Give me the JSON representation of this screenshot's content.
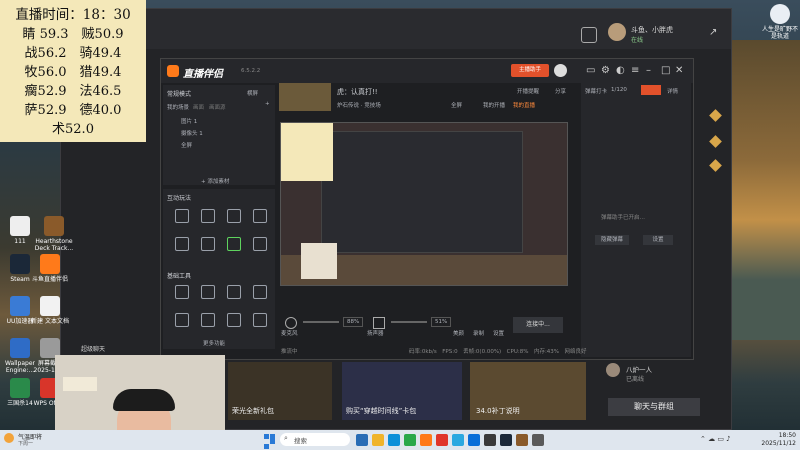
{
  "stats": {
    "title": "直播时间：18：30",
    "rows": [
      "睛 59.3　贼50.9",
      "战56.2　骑49.4",
      "牧56.0　猎49.4",
      "瘸52.9　法46.5",
      "萨52.9　德40.0",
      "术52.0"
    ]
  },
  "desktop_icons": [
    {
      "label": "111"
    },
    {
      "label": "Hearthstone Deck Track..."
    },
    {
      "label": "Steam"
    },
    {
      "label": "斗鱼直播伴侣"
    },
    {
      "label": "UU加速器"
    },
    {
      "label": "新建 文本文档"
    },
    {
      "label": "Wallpaper Engine:..."
    },
    {
      "label": "屏幕截图 2025-10-..."
    },
    {
      "label": "三国杀14"
    },
    {
      "label": "WPS Office"
    }
  ],
  "top_right_icon": {
    "label": "人生是旷野不是轨道"
  },
  "mainwin": {
    "user_name": "斗鱼、小胖虎",
    "user_status": "在线",
    "bottom_label": "超级聊天"
  },
  "sp": {
    "app_name": "直播伴侣",
    "version": "6.5.2.2",
    "header_buttons": {
      "broadcast": "主播助手",
      "open_live": "开播提醒",
      "share": "分享"
    },
    "left": {
      "mode": "常规模式",
      "landscape": "横屏",
      "scene_tabs": [
        "我的场景",
        "画面",
        "画面源"
      ],
      "sources": [
        "图片 1",
        "摄像头 1",
        "全屏"
      ],
      "add_source": "+ 添加素材",
      "section_interact": "互动玩法",
      "section_basic": "基础工具",
      "more": "更多功能"
    },
    "center": {
      "stream_title": "虎：认真打!!",
      "tag1": "炉石传说 · 竞技场",
      "actions": [
        "全屏",
        "我的开播",
        "我的直播"
      ],
      "mic_label": "麦克风",
      "mic_pct": "88%",
      "speaker_label": "扬声器",
      "speaker_pct": "51%",
      "bottom_tools": [
        "美颜",
        "录制",
        "设置"
      ],
      "connect_btn": "连接中...",
      "status_left": "推流中",
      "status_right": "码率:0kb/s　FPS:0　丢帧:0(0.00%)　CPU:8%　内存:43%　网络良好"
    },
    "right": {
      "tab_label": "弹幕打卡",
      "counter": "1/120",
      "tab_detail": "详情",
      "empty_hint": "弹幕助手已开启…",
      "btn1": "隐藏弹幕",
      "btn2": "设置"
    }
  },
  "bottom_cards": [
    {
      "caption": "荣光全新礼包"
    },
    {
      "caption": "购买“穿越时间线”卡包"
    },
    {
      "caption": "34.0补丁说明"
    }
  ],
  "user_card": {
    "name": "八炉一人",
    "status": "已离线"
  },
  "chat_button": "聊天与群组",
  "taskbar": {
    "weather": "气温即将",
    "weather_sub": "下周一",
    "search": "搜索",
    "time": "18:50",
    "date": "2025/11/12"
  }
}
